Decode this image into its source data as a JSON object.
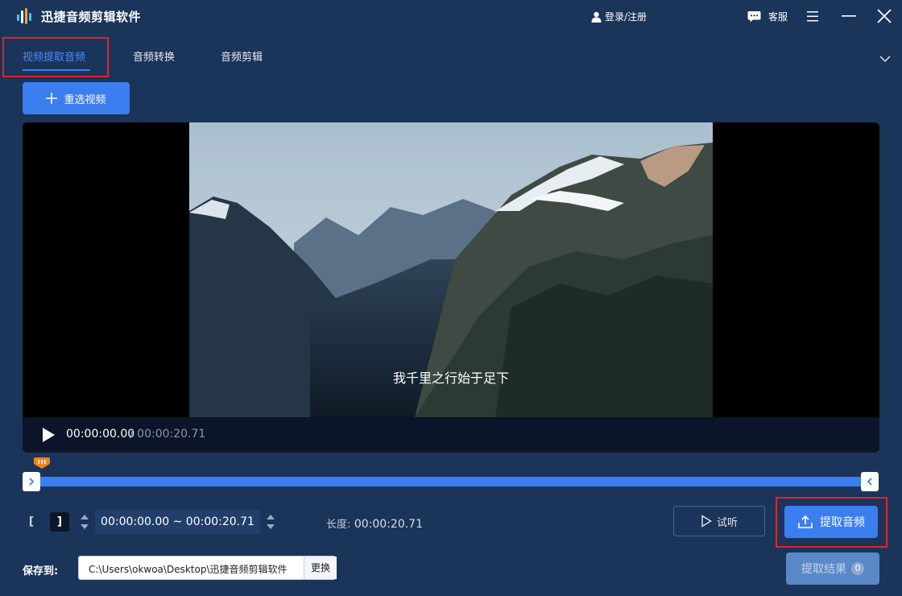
{
  "app": {
    "title": "迅捷音频剪辑软件"
  },
  "header": {
    "login_label": "登录/注册",
    "service_label": "客服"
  },
  "tabs": [
    {
      "label": "视频提取音频",
      "active": true
    },
    {
      "label": "音频转换",
      "active": false
    },
    {
      "label": "音频剪辑",
      "active": false
    }
  ],
  "toolbar": {
    "reselect_label": "重选视频"
  },
  "player": {
    "subtitle": "我千里之行始于足下",
    "current_time": "00:00:00.00",
    "total_time": "/ 00:00:20.71"
  },
  "range": {
    "value": "00:00:00.00 ~ 00:00:20.71",
    "length_label": "长度:",
    "length_value": "00:00:20.71",
    "start_fraction": 0,
    "end_fraction": 1,
    "playhead_fraction": 0
  },
  "actions": {
    "listen_label": "试听",
    "extract_label": "提取音频",
    "result_label": "提取结果",
    "result_count": "0"
  },
  "save": {
    "label": "保存到:",
    "path": "C:\\Users\\okwoa\\Desktop\\迅捷音频剪辑软件",
    "change_label": "更换"
  },
  "colors": {
    "background": "#1b3459",
    "accent": "#3a7ef0",
    "highlight_box": "#e0242b",
    "active_tab": "#4e8bff",
    "playhead": "#f0841e"
  }
}
